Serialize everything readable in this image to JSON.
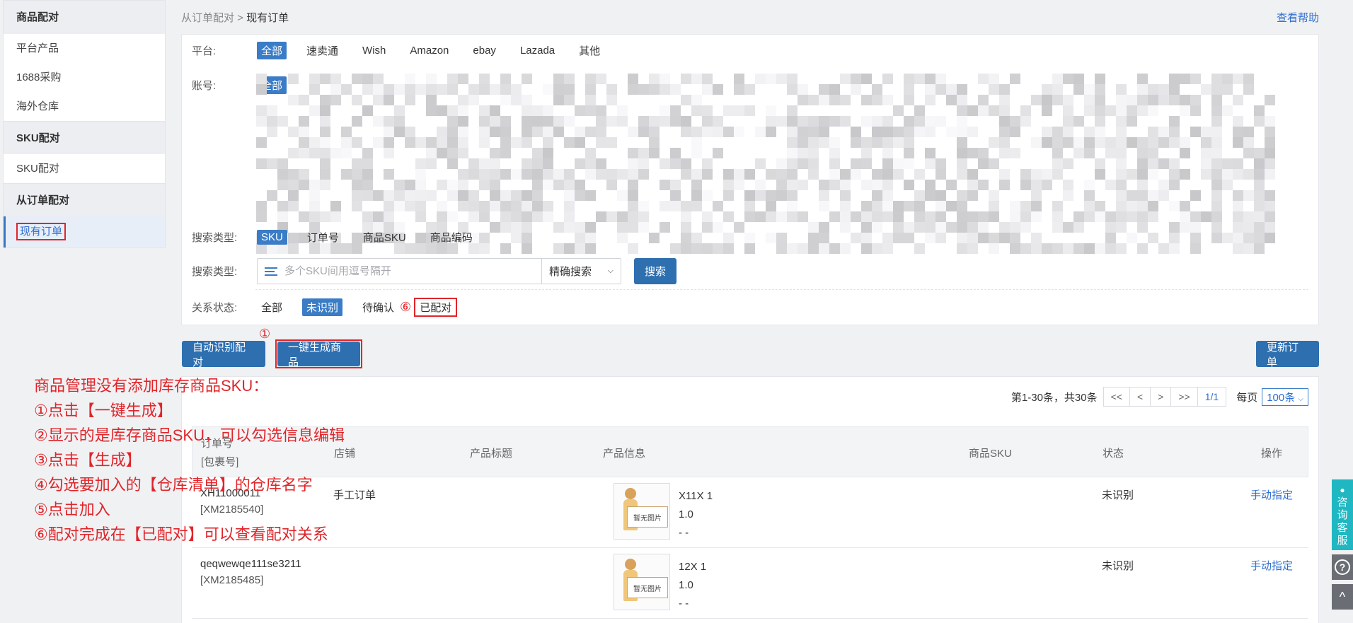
{
  "sidebar": {
    "groups": [
      {
        "label": "商品配对",
        "items": [
          "平台产品",
          "1688采购",
          "海外仓库"
        ]
      },
      {
        "label": "SKU配对",
        "items": [
          "SKU配对"
        ]
      },
      {
        "label": "从订单配对",
        "items": [
          "现有订单"
        ]
      }
    ]
  },
  "breadcrumb": {
    "parent": "从订单配对",
    "sep": " > ",
    "current": "现有订单"
  },
  "help": "查看帮助",
  "filters": {
    "platform": {
      "label": "平台:",
      "options": [
        "全部",
        "速卖通",
        "Wish",
        "Amazon",
        "ebay",
        "Lazada",
        "其他"
      ]
    },
    "account": {
      "label": "账号:",
      "options": [
        "全部"
      ]
    },
    "search_type": {
      "label": "搜索类型:",
      "options": [
        "SKU",
        "订单号",
        "商品SKU",
        "商品编码"
      ]
    },
    "search": {
      "label": "搜索类型:",
      "placeholder": "多个SKU间用逗号隔开",
      "mode": "精确搜索",
      "button": "搜索"
    },
    "relation": {
      "label": "关系状态:",
      "options": [
        "全部",
        "未识别",
        "待确认",
        "已配对"
      ],
      "circle": "⑥"
    }
  },
  "actions": {
    "auto": "自动识别配对",
    "generate": "一键生成商品",
    "update": "更新订单",
    "circle": "①"
  },
  "pager": {
    "summary": "第1-30条，共30条",
    "buttons": [
      "<<",
      "<",
      ">",
      ">>",
      "1/1"
    ],
    "per_label": "每页",
    "per_value": "100条"
  },
  "table": {
    "headers": {
      "order": "订单号",
      "package": "[包裹号]",
      "shop": "店铺",
      "title": "产品标题",
      "info": "产品信息",
      "sku": "商品SKU",
      "status": "状态",
      "op": "操作"
    },
    "rows": [
      {
        "order": "XH11000011",
        "package": "[XM2185540]",
        "shop": "手工订单",
        "sku_line": "X11X 1",
        "price": "1.0",
        "extra": "- -",
        "status": "未识别",
        "op": "手动指定",
        "img_text": "暂无图片"
      },
      {
        "order": "qeqwewqe111se3211",
        "package": "[XM2185485]",
        "shop": "",
        "sku_line": "12X 1",
        "price": "1.0",
        "extra": "- -",
        "status": "未识别",
        "op": "手动指定",
        "img_text": "暂无图片"
      }
    ]
  },
  "annotations": [
    "商品管理没有添加库存商品SKU：",
    "①点击【一键生成】",
    "②显示的是库存商品SKU，可以勾选信息编辑",
    "③点击【生成】",
    "④勾选要加入的【仓库清单】的仓库名字",
    "⑤点击加入",
    "⑥配对完成在【已配对】可以查看配对关系"
  ],
  "float": {
    "cs_label": "咨询客服",
    "question": "?",
    "up": "^"
  }
}
